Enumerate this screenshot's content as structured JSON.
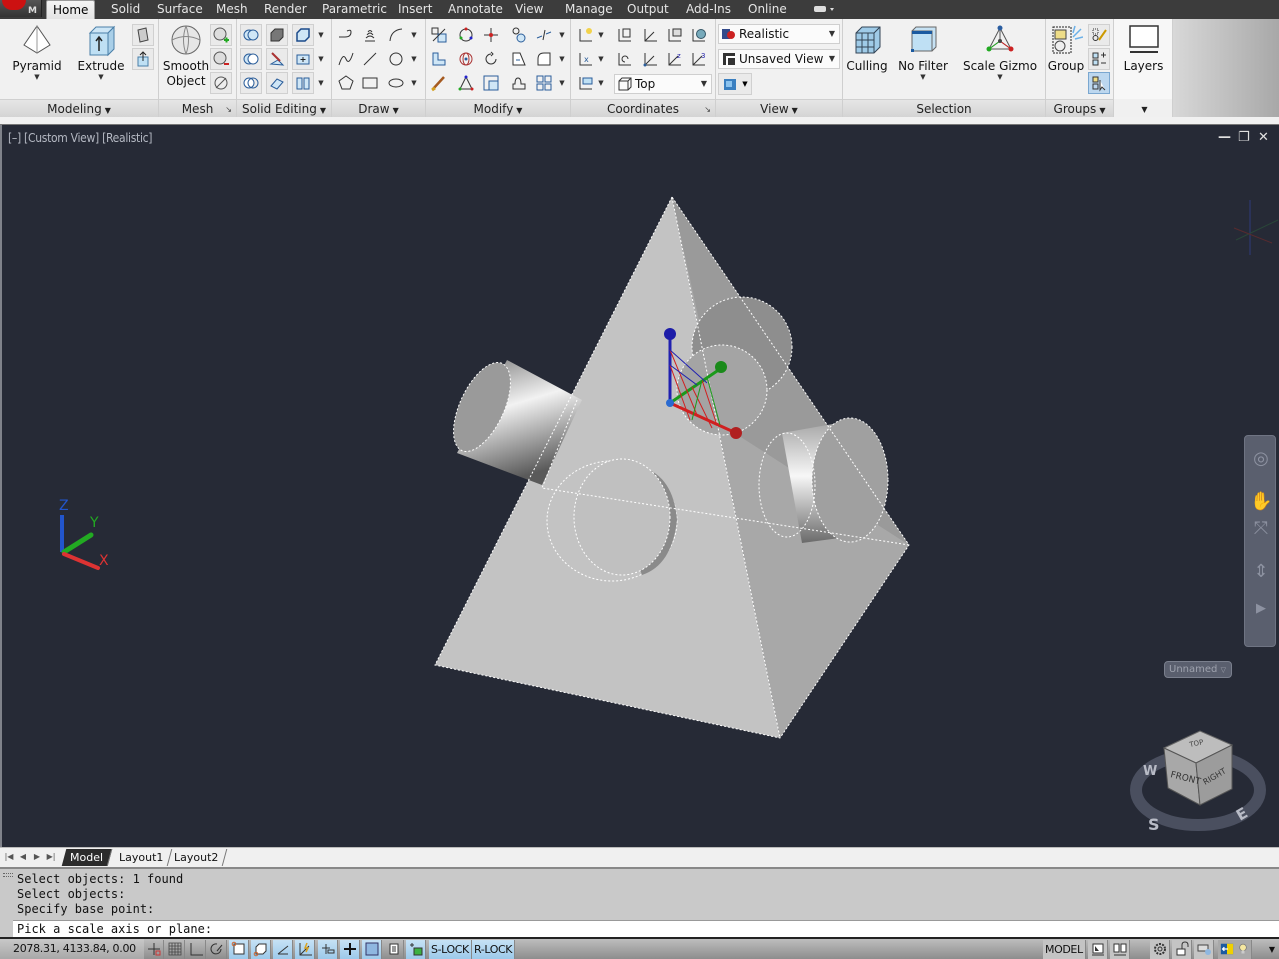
{
  "app": {
    "menu_letter": "M",
    "accent_color": "#cc1111"
  },
  "tabs": [
    {
      "label": "Home",
      "active": true
    },
    {
      "label": "Solid"
    },
    {
      "label": "Surface"
    },
    {
      "label": "Mesh"
    },
    {
      "label": "Render"
    },
    {
      "label": "Parametric"
    },
    {
      "label": "Insert"
    },
    {
      "label": "Annotate"
    },
    {
      "label": "View"
    },
    {
      "label": "Manage"
    },
    {
      "label": "Output"
    },
    {
      "label": "Add-Ins"
    },
    {
      "label": "Online"
    }
  ],
  "ribbon": {
    "panels": {
      "modeling": {
        "title": "Modeling",
        "buttons": [
          {
            "label": "Pyramid",
            "icon": "pyramid-icon"
          },
          {
            "label": "Extrude",
            "icon": "extrude-icon"
          }
        ]
      },
      "mesh": {
        "title": "Mesh",
        "buttons": [
          {
            "label_line1": "Smooth",
            "label_line2": "Object",
            "icon": "smooth-object-icon"
          }
        ]
      },
      "solid_editing": {
        "title": "Solid Editing"
      },
      "draw": {
        "title": "Draw"
      },
      "modify": {
        "title": "Modify"
      },
      "coordinates": {
        "title": "Coordinates",
        "ucs_view": "Top"
      },
      "view": {
        "title": "View",
        "visual_style": "Realistic",
        "named_view": "Unsaved View"
      },
      "selection": {
        "title": "Selection",
        "buttons": [
          {
            "label": "Culling",
            "icon": "culling-icon"
          },
          {
            "label": "No Filter",
            "icon": "no-filter-icon"
          },
          {
            "label": "Scale Gizmo",
            "icon": "scale-gizmo-icon"
          }
        ]
      },
      "groups": {
        "title": "Groups",
        "buttons": [
          {
            "label": "Group",
            "icon": "group-icon"
          }
        ]
      },
      "layers": {
        "title": "",
        "buttons": [
          {
            "label": "Layers",
            "icon": "layers-icon"
          }
        ]
      }
    }
  },
  "viewport": {
    "label": "[–] [Custom View] [Realistic]",
    "minimize": "—",
    "restore": "❐",
    "close": "✕",
    "ucs": {
      "x": "X",
      "y": "Y",
      "z": "Z"
    },
    "viewcube": {
      "top": "TOP",
      "front": "FRONT",
      "right": "RIGHT",
      "compass": {
        "w": "W",
        "s": "S",
        "e": "E"
      }
    },
    "named_ucs": "Unnamed",
    "background_color": "#262a36"
  },
  "layout_tabs": [
    {
      "label": "Model",
      "active": true
    },
    {
      "label": "Layout1"
    },
    {
      "label": "Layout2"
    }
  ],
  "command": {
    "history": [
      "Select objects: 1 found",
      "Select objects:",
      "Specify base point:"
    ],
    "prompt": "Pick a scale axis or plane:"
  },
  "status": {
    "coords": "2078.31, 4133.84, 0.00",
    "toggles": [
      {
        "name": "infer-constraints",
        "on": false
      },
      {
        "name": "snap-mode",
        "on": false
      },
      {
        "name": "grid-display",
        "on": false
      },
      {
        "name": "ortho-mode",
        "on": false
      },
      {
        "name": "polar-tracking",
        "on": false
      },
      {
        "name": "object-snap",
        "on": true
      },
      {
        "name": "3d-object-snap",
        "on": true
      },
      {
        "name": "object-snap-tracking",
        "on": true
      },
      {
        "name": "dynamic-ucs",
        "on": true
      },
      {
        "name": "dynamic-input",
        "on": true
      },
      {
        "name": "show-lineweight",
        "on": true
      },
      {
        "name": "transparency",
        "on": true
      },
      {
        "name": "quick-properties",
        "on": false
      },
      {
        "name": "selection-cycling",
        "on": true
      }
    ],
    "slock": "S-LOCK",
    "rlock": "R-LOCK",
    "model": "MODEL"
  }
}
